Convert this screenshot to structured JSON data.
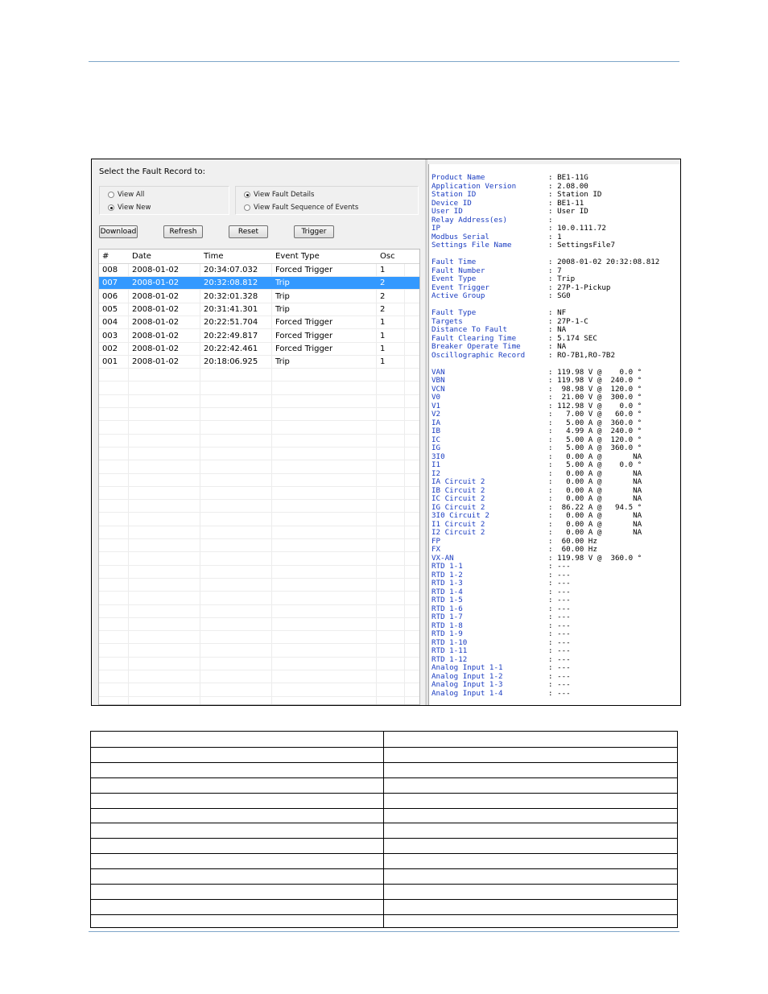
{
  "fault_panel": {
    "select_label": "Select the Fault Record to:",
    "view_options": [
      {
        "label": "View All",
        "selected": false
      },
      {
        "label": "View New",
        "selected": true
      }
    ],
    "detail_options": [
      {
        "label": "View Fault Details",
        "selected": true
      },
      {
        "label": "View Fault Sequence of Events",
        "selected": false
      }
    ],
    "buttons": {
      "download": "Download",
      "refresh": "Refresh",
      "reset": "Reset",
      "trigger": "Trigger"
    },
    "columns": [
      "#",
      "Date",
      "Time",
      "Event Type",
      "Osc"
    ],
    "records": [
      {
        "num": "008",
        "date": "2008-01-02",
        "time": "20:34:07.032",
        "event": "Forced Trigger",
        "osc": "1",
        "selected": false
      },
      {
        "num": "007",
        "date": "2008-01-02",
        "time": "20:32:08.812",
        "event": "Trip",
        "osc": "2",
        "selected": true
      },
      {
        "num": "006",
        "date": "2008-01-02",
        "time": "20:32:01.328",
        "event": "Trip",
        "osc": "2",
        "selected": false
      },
      {
        "num": "005",
        "date": "2008-01-02",
        "time": "20:31:41.301",
        "event": "Trip",
        "osc": "2",
        "selected": false
      },
      {
        "num": "004",
        "date": "2008-01-02",
        "time": "20:22:51.704",
        "event": "Forced Trigger",
        "osc": "1",
        "selected": false
      },
      {
        "num": "003",
        "date": "2008-01-02",
        "time": "20:22:49.817",
        "event": "Forced Trigger",
        "osc": "1",
        "selected": false
      },
      {
        "num": "002",
        "date": "2008-01-02",
        "time": "20:22:42.461",
        "event": "Forced Trigger",
        "osc": "1",
        "selected": false
      },
      {
        "num": "001",
        "date": "2008-01-02",
        "time": "20:18:06.925",
        "event": "Trip",
        "osc": "1",
        "selected": false
      }
    ]
  },
  "fault_details": [
    {
      "label": "Product Name",
      "value": ": BE1-11G"
    },
    {
      "label": "Application Version",
      "value": ": 2.08.00"
    },
    {
      "label": "Station ID",
      "value": ": Station ID"
    },
    {
      "label": "Device ID",
      "value": ": BE1-11"
    },
    {
      "label": "User ID",
      "value": ": User ID"
    },
    {
      "label": "Relay Address(es)",
      "value": ":"
    },
    {
      "label": "IP",
      "value": ": 10.0.111.72"
    },
    {
      "label": "Modbus Serial",
      "value": ": 1"
    },
    {
      "label": "Settings File Name",
      "value": ": SettingsFile7"
    },
    {
      "label": "",
      "value": ""
    },
    {
      "label": "Fault Time",
      "value": ": 2008-01-02 20:32:08.812"
    },
    {
      "label": "Fault Number",
      "value": ": 7"
    },
    {
      "label": "Event Type",
      "value": ": Trip"
    },
    {
      "label": "Event Trigger",
      "value": ": 27P-1-Pickup"
    },
    {
      "label": "Active Group",
      "value": ": SG0"
    },
    {
      "label": "",
      "value": ""
    },
    {
      "label": "Fault Type",
      "value": ": NF"
    },
    {
      "label": "Targets",
      "value": ": 27P-1-C"
    },
    {
      "label": "Distance To Fault",
      "value": ": NA"
    },
    {
      "label": "Fault Clearing Time",
      "value": ": 5.174 SEC"
    },
    {
      "label": "Breaker Operate Time",
      "value": ": NA"
    },
    {
      "label": "Oscillographic Record",
      "value": ": RO-7B1,RO-7B2"
    },
    {
      "label": "",
      "value": ""
    },
    {
      "label": "VAN",
      "value": ": 119.98 V @    0.0 °"
    },
    {
      "label": "VBN",
      "value": ": 119.98 V @  240.0 °"
    },
    {
      "label": "VCN",
      "value": ":  98.98 V @  120.0 °"
    },
    {
      "label": "V0",
      "value": ":  21.00 V @  300.0 °"
    },
    {
      "label": "V1",
      "value": ": 112.98 V @    0.0 °"
    },
    {
      "label": "V2",
      "value": ":   7.00 V @   60.0 °"
    },
    {
      "label": "IA",
      "value": ":   5.00 A @  360.0 °"
    },
    {
      "label": "IB",
      "value": ":   4.99 A @  240.0 °"
    },
    {
      "label": "IC",
      "value": ":   5.00 A @  120.0 °"
    },
    {
      "label": "IG",
      "value": ":   5.00 A @  360.0 °"
    },
    {
      "label": "3I0",
      "value": ":   0.00 A @       NA"
    },
    {
      "label": "I1",
      "value": ":   5.00 A @    0.0 °"
    },
    {
      "label": "I2",
      "value": ":   0.00 A @       NA"
    },
    {
      "label": "IA Circuit 2",
      "value": ":   0.00 A @       NA"
    },
    {
      "label": "IB Circuit 2",
      "value": ":   0.00 A @       NA"
    },
    {
      "label": "IC Circuit 2",
      "value": ":   0.00 A @       NA"
    },
    {
      "label": "IG Circuit 2",
      "value": ":  86.22 A @   94.5 °"
    },
    {
      "label": "3I0 Circuit 2",
      "value": ":   0.00 A @       NA"
    },
    {
      "label": "I1 Circuit 2",
      "value": ":   0.00 A @       NA"
    },
    {
      "label": "I2 Circuit 2",
      "value": ":   0.00 A @       NA"
    },
    {
      "label": "FP",
      "value": ":  60.00 Hz"
    },
    {
      "label": "FX",
      "value": ":  60.00 Hz"
    },
    {
      "label": "VX-AN",
      "value": ": 119.98 V @  360.0 °"
    },
    {
      "label": "RTD 1-1",
      "value": ": ---"
    },
    {
      "label": "RTD 1-2",
      "value": ": ---"
    },
    {
      "label": "RTD 1-3",
      "value": ": ---"
    },
    {
      "label": "RTD 1-4",
      "value": ": ---"
    },
    {
      "label": "RTD 1-5",
      "value": ": ---"
    },
    {
      "label": "RTD 1-6",
      "value": ": ---"
    },
    {
      "label": "RTD 1-7",
      "value": ": ---"
    },
    {
      "label": "RTD 1-8",
      "value": ": ---"
    },
    {
      "label": "RTD 1-9",
      "value": ": ---"
    },
    {
      "label": "RTD 1-10",
      "value": ": ---"
    },
    {
      "label": "RTD 1-11",
      "value": ": ---"
    },
    {
      "label": "RTD 1-12",
      "value": ": ---"
    },
    {
      "label": "Analog Input 1-1",
      "value": ": ---"
    },
    {
      "label": "Analog Input 1-2",
      "value": ": ---"
    },
    {
      "label": "Analog Input 1-3",
      "value": ": ---"
    },
    {
      "label": "Analog Input 1-4",
      "value": ": ---"
    }
  ],
  "colors": {
    "selection": "#3399ff",
    "label_blue": "#1a3cc0",
    "rule": "#7fa6c9"
  }
}
